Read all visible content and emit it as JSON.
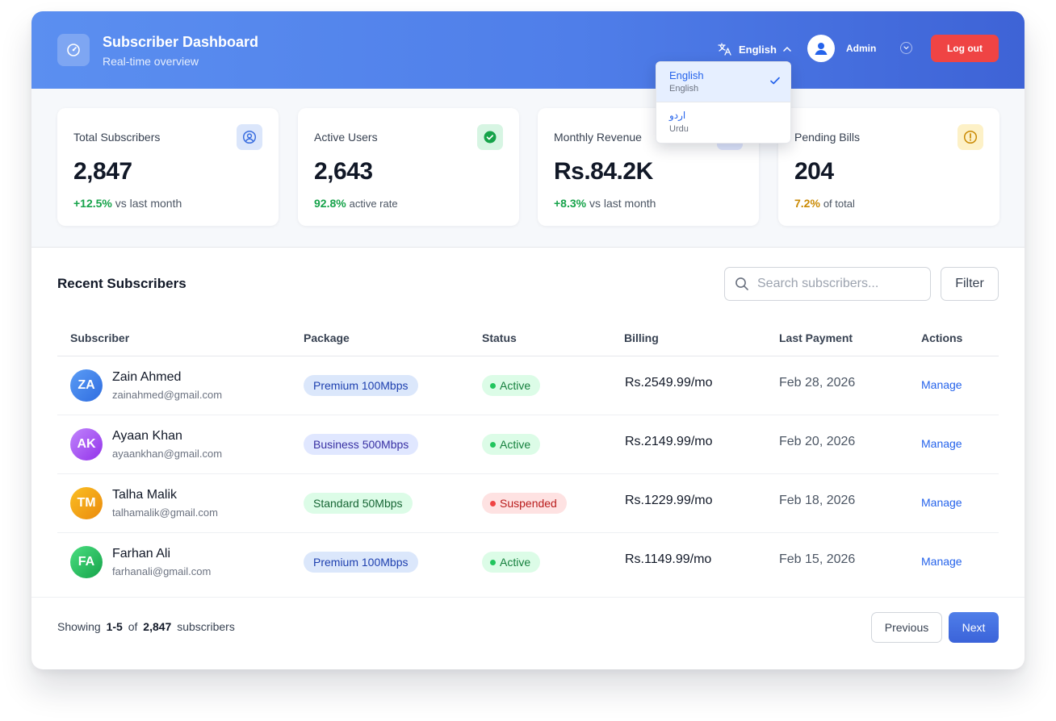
{
  "header": {
    "title": "Subscriber Dashboard",
    "subtitle": "Real-time overview",
    "language_label": "English",
    "admin_name": "Admin",
    "logout_label": "Log out"
  },
  "language_menu": {
    "items": [
      {
        "label": "English",
        "sub": "English",
        "selected": true
      },
      {
        "label": "اردو",
        "sub": "Urdu",
        "selected": false
      }
    ]
  },
  "stats": [
    {
      "label": "Total Subscribers",
      "value": "2,847",
      "delta": "+12.5%",
      "delta_text": "vs last month",
      "delta_color": "#16a34a",
      "icon": "user-circle-icon"
    },
    {
      "label": "Active Users",
      "value": "2,643",
      "delta": "92.8%",
      "delta_text": "active rate",
      "delta_color": "#16a34a",
      "icon": "check-circle-icon"
    },
    {
      "label": "Monthly Revenue",
      "value": "Rs.84.2K",
      "delta": "+8.3%",
      "delta_text": "vs last month",
      "delta_color": "#16a34a",
      "icon": "revenue-icon"
    },
    {
      "label": "Pending Bills",
      "value": "204",
      "delta": "7.2%",
      "delta_text": "of total",
      "delta_color": "#ca8a04",
      "icon": "alert-circle-icon"
    }
  ],
  "table": {
    "title": "Recent Subscribers",
    "search_placeholder": "Search subscribers...",
    "filter_label": "Filter",
    "columns": [
      "Subscriber",
      "Package",
      "Status",
      "Billing",
      "Last Payment",
      "Actions"
    ],
    "rows": [
      {
        "initials": "ZA",
        "name": "Zain Ahmed",
        "email": "zainahmed@gmail.com",
        "package": "Premium 100Mbps",
        "status": "Active",
        "billing": "Rs.2549.99/mo",
        "last_payment": "Feb 28, 2026",
        "action": "Manage"
      },
      {
        "initials": "AK",
        "name": "Ayaan Khan",
        "email": "ayaankhan@gmail.com",
        "package": "Business 500Mbps",
        "status": "Active",
        "billing": "Rs.2149.99/mo",
        "last_payment": "Feb 20, 2026",
        "action": "Manage"
      },
      {
        "initials": "TM",
        "name": "Talha Malik",
        "email": "talhamalik@gmail.com",
        "package": "Standard 50Mbps",
        "status": "Suspended",
        "billing": "Rs.1229.99/mo",
        "last_payment": "Feb 18, 2026",
        "action": "Manage"
      },
      {
        "initials": "FA",
        "name": "Farhan Ali",
        "email": "farhanali@gmail.com",
        "package": "Premium 100Mbps",
        "status": "Active",
        "billing": "Rs.1149.99/mo",
        "last_payment": "Feb 15, 2026",
        "action": "Manage"
      }
    ]
  },
  "pagination": {
    "showing_prefix": "Showing",
    "range": "1-5",
    "of_label": "of",
    "total": "2,847",
    "suffix": "subscribers",
    "prev_label": "Previous",
    "next_label": "Next"
  },
  "colors": {
    "header_start": "#5b8ff0",
    "header_end": "#3e63d6",
    "danger": "#ef4444",
    "link": "#2563eb"
  }
}
